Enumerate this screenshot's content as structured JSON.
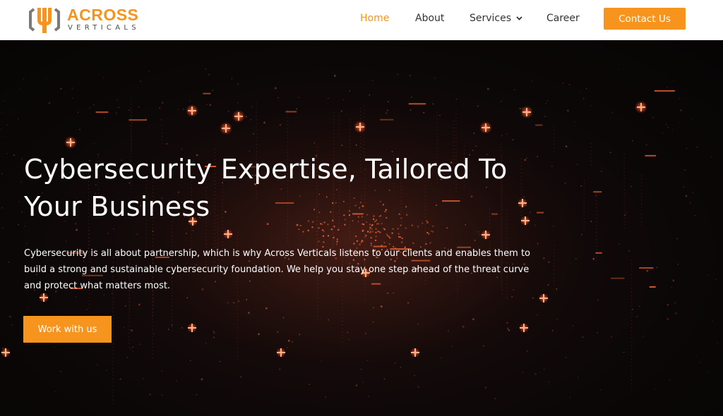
{
  "brand": {
    "name": "ACROSS",
    "tagline": "VERTICALS",
    "accent_color": "#f7941d",
    "logo_icon": "across-verticals-logo-icon"
  },
  "nav": {
    "items": [
      {
        "label": "Home",
        "active": true
      },
      {
        "label": "About",
        "active": false
      },
      {
        "label": "Services",
        "active": false,
        "has_dropdown": true
      },
      {
        "label": "Career",
        "active": false
      }
    ],
    "dropdown_icon": "chevron-down-icon",
    "contact_label": "Contact Us"
  },
  "hero": {
    "title_line1": "Cybersecurity Expertise, Tailored To",
    "title_line2": "Your Business",
    "description_line1": "Cybersecurity is all about partnership, which is why Across Verticals listens to our clients and enables them to",
    "description_line2": "build a strong and sustainable cybersecurity foundation. We help you stay one step ahead of the threat curve",
    "description_line3": "and protect what matters most.",
    "cta_label": "Work with us",
    "background_image": "dark-digital-particles-orange"
  }
}
